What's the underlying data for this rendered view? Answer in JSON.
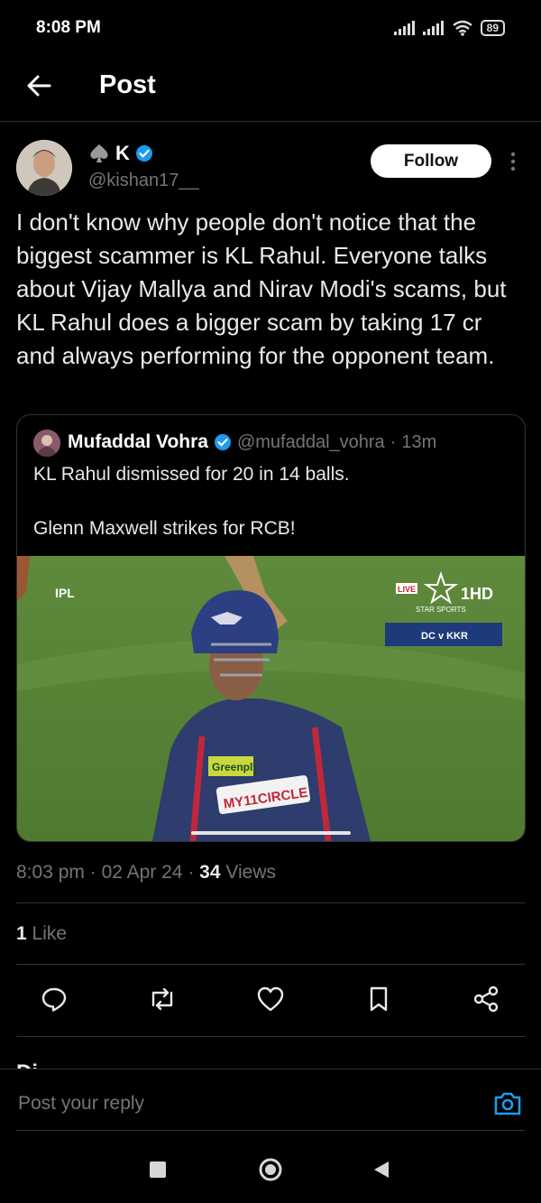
{
  "status_bar": {
    "time": "8:08 PM",
    "battery": "89"
  },
  "header": {
    "title": "Post"
  },
  "author": {
    "name": "K",
    "handle": "@kishan17__",
    "follow_label": "Follow"
  },
  "tweet": {
    "text": "I don't know why people don't notice that the biggest scammer is KL Rahul. Everyone talks about Vijay Mallya and Nirav Modi's scams, but KL Rahul does a bigger scam by taking 17 cr and always performing for the opponent team."
  },
  "quote": {
    "name": "Mufaddal Vohra",
    "handle": "@mufaddal_vohra",
    "separator": "·",
    "time": "13m",
    "line1": "KL Rahul dismissed for 20 in 14 balls.",
    "line2": "Glenn Maxwell strikes for RCB!",
    "image_overlay": {
      "ipl": "IPL",
      "live": "LIVE",
      "channel": "1HD",
      "broadcaster": "STAR SPORTS",
      "matchup": "DC v KKR",
      "sponsor1": "Greenply",
      "sponsor2": "MY11CIRCLE"
    }
  },
  "meta": {
    "time": "8:03 pm",
    "date": "02 Apr 24",
    "dot": "·",
    "views_count": "34",
    "views_label": "Views"
  },
  "likes": {
    "count": "1",
    "label": "Like"
  },
  "actions": [
    "reply-icon",
    "retweet-icon",
    "like-icon",
    "bookmark-icon",
    "share-icon"
  ],
  "replies_heading": "Di",
  "reply": {
    "placeholder": "Post your reply"
  },
  "colors": {
    "background": "#000000",
    "text": "#e7e9ea",
    "muted": "#71767b",
    "accent": "#1d9bf0",
    "divider": "#2f3336"
  }
}
